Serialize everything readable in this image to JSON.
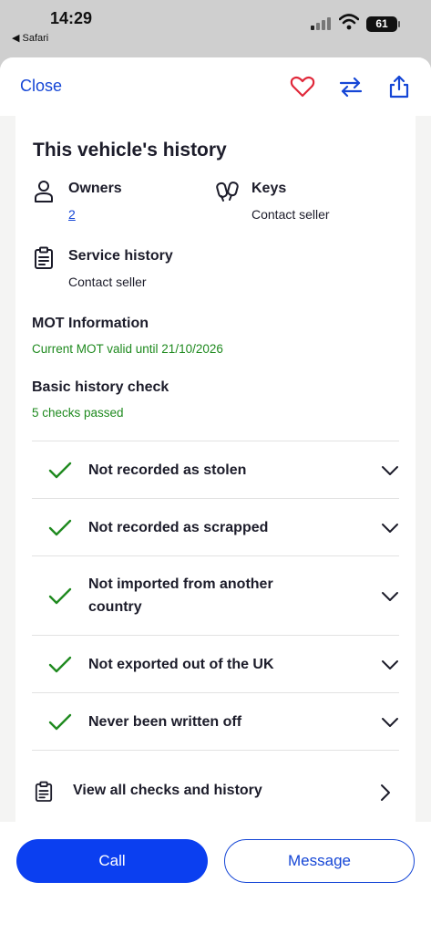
{
  "status_bar": {
    "time": "14:29",
    "back_app": "◀ Safari",
    "battery": "61"
  },
  "header": {
    "close_label": "Close"
  },
  "history": {
    "title": "This vehicle's history",
    "owners": {
      "label": "Owners",
      "value": "2"
    },
    "keys": {
      "label": "Keys",
      "value": "Contact seller"
    },
    "service": {
      "label": "Service history",
      "value": "Contact seller"
    },
    "mot": {
      "label": "MOT Information",
      "value": "Current MOT valid until 21/10/2026"
    },
    "basic_check": {
      "label": "Basic history check",
      "value": "5 checks passed"
    },
    "checks": [
      "Not recorded as stolen",
      "Not recorded as scrapped",
      "Not imported from another country",
      "Not exported out of the UK",
      "Never been written off"
    ],
    "view_all": "View all checks and history"
  },
  "actions": {
    "call": "Call",
    "message": "Message"
  },
  "colors": {
    "accent": "#1546d6",
    "primary_button": "#0b3ff0",
    "success": "#1f8a1f",
    "heart": "#e0283a"
  }
}
